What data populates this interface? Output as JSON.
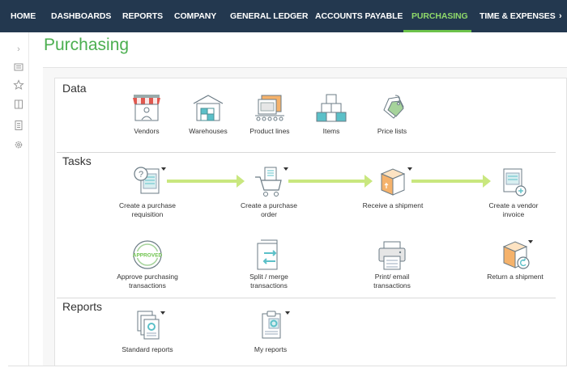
{
  "nav": {
    "items": [
      {
        "label": "HOME"
      },
      {
        "label": "DASHBOARDS"
      },
      {
        "label": "REPORTS"
      },
      {
        "label": "COMPANY"
      },
      {
        "label": "GENERAL LEDGER"
      },
      {
        "label": "ACCOUNTS PAYABLE"
      },
      {
        "label": "PURCHASING",
        "active": true
      },
      {
        "label": "TIME & EXPENSES"
      }
    ],
    "more": "›"
  },
  "sidebar": {
    "icons": [
      "expand-chevron-icon",
      "list-icon",
      "star-icon",
      "columns-icon",
      "document-icon",
      "gear-icon"
    ],
    "expand_glyph": "›"
  },
  "page": {
    "title": "Purchasing"
  },
  "sections": {
    "data": {
      "label": "Data",
      "items": [
        {
          "label": "Vendors",
          "icon": "vendors-icon"
        },
        {
          "label": "Warehouses",
          "icon": "warehouse-icon"
        },
        {
          "label": "Product lines",
          "icon": "product-lines-icon"
        },
        {
          "label": "Items",
          "icon": "items-icon"
        },
        {
          "label": "Price lists",
          "icon": "price-tag-icon"
        }
      ]
    },
    "tasks": {
      "label": "Tasks",
      "items": [
        {
          "label_1": "Create a purchase",
          "label_2": "requisition",
          "icon": "requisition-icon"
        },
        {
          "label_1": "Create a purchase",
          "label_2": "order",
          "icon": "cart-icon"
        },
        {
          "label_1": "Receive a shipment",
          "label_2": "",
          "icon": "box-icon"
        },
        {
          "label_1": "Create a vendor",
          "label_2": "invoice",
          "icon": "invoice-icon"
        },
        {
          "label_1": "Approve purchasing",
          "label_2": "transactions",
          "icon": "approved-stamp-icon",
          "stamp_text": "APPROVED"
        },
        {
          "label_1": "Split / merge",
          "label_2": "transactions",
          "icon": "split-merge-icon"
        },
        {
          "label_1": "Print/ email",
          "label_2": "transactions",
          "icon": "printer-icon"
        },
        {
          "label_1": "Return a shipment",
          "label_2": "",
          "icon": "return-box-icon"
        }
      ]
    },
    "reports": {
      "label": "Reports",
      "items": [
        {
          "label": "Standard reports",
          "icon": "standard-reports-icon"
        },
        {
          "label": "My reports",
          "icon": "my-reports-icon"
        }
      ]
    }
  },
  "colors": {
    "nav_bg": "#23384f",
    "accent_green": "#4caf50",
    "arrow_green": "#c9e77f",
    "teal": "#5bc0c8",
    "orange": "#f5b26b",
    "red": "#e0584f"
  }
}
